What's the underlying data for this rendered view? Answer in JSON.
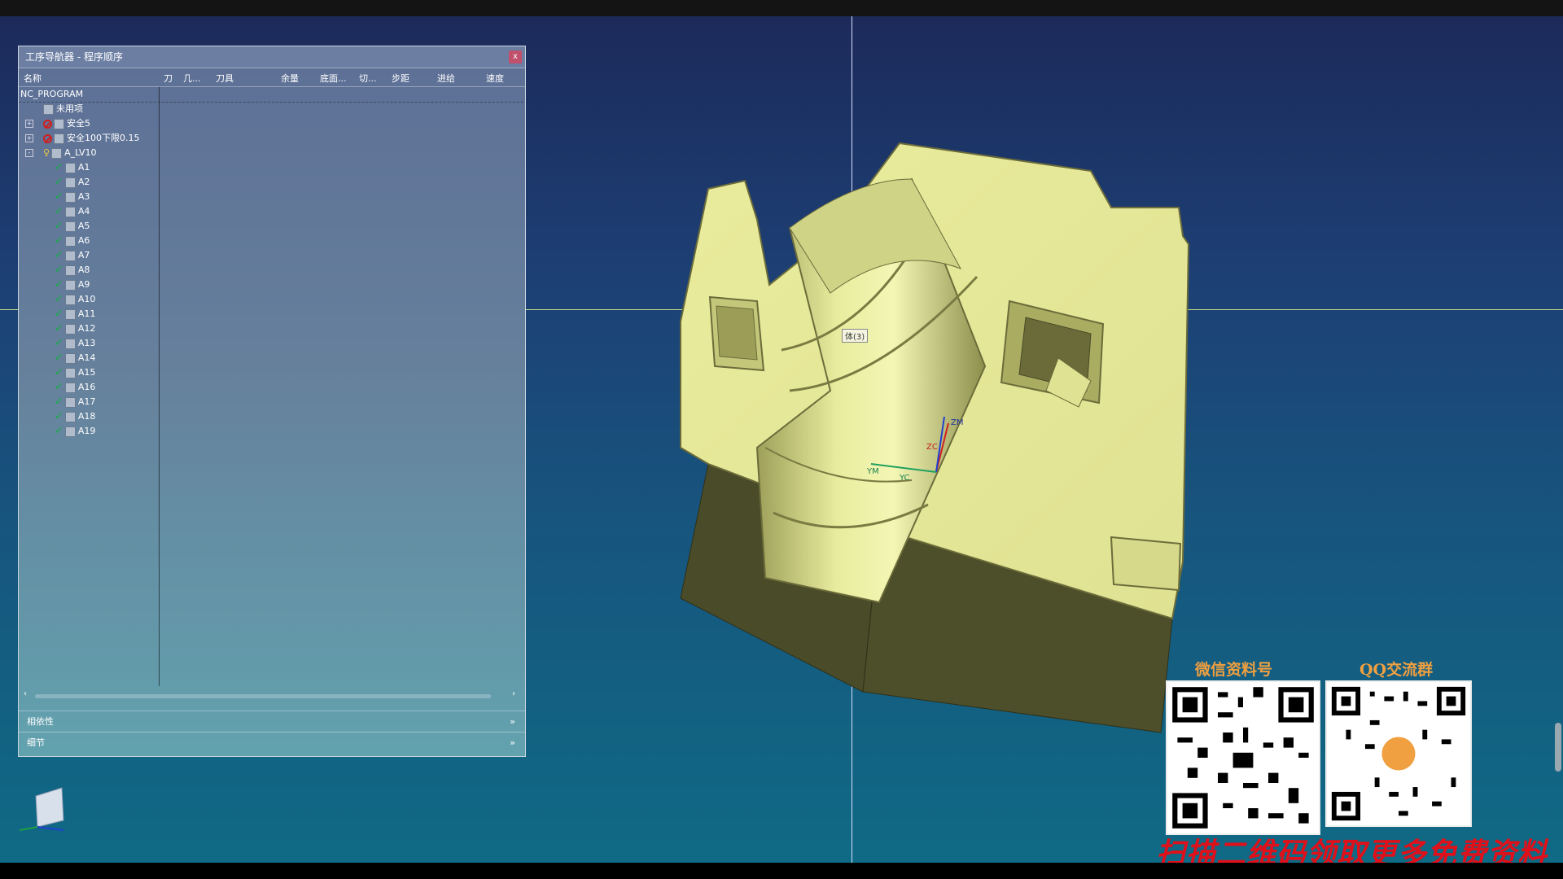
{
  "panel": {
    "title": "工序导航器 - 程序顺序",
    "close_label": "x",
    "columns": [
      "名称",
      "刀",
      "几...",
      "刀具",
      "余量",
      "底面...",
      "切...",
      "步距",
      "进给",
      "速度"
    ],
    "tree": [
      {
        "label": "NC_PROGRAM",
        "status": "none",
        "level": 0,
        "expander": ""
      },
      {
        "label": "未用项",
        "status": "none",
        "level": 1,
        "expander": ""
      },
      {
        "label": "安全5",
        "status": "blocked",
        "level": 1,
        "expander": "+"
      },
      {
        "label": "安全100下限0.15",
        "status": "blocked",
        "level": 1,
        "expander": "+"
      },
      {
        "label": "A_LV10",
        "status": "pending",
        "level": 1,
        "expander": "-"
      },
      {
        "label": "A1",
        "status": "ok",
        "level": 2,
        "expander": ""
      },
      {
        "label": "A2",
        "status": "ok",
        "level": 2,
        "expander": ""
      },
      {
        "label": "A3",
        "status": "ok",
        "level": 2,
        "expander": ""
      },
      {
        "label": "A4",
        "status": "ok",
        "level": 2,
        "expander": ""
      },
      {
        "label": "A5",
        "status": "ok",
        "level": 2,
        "expander": ""
      },
      {
        "label": "A6",
        "status": "ok",
        "level": 2,
        "expander": ""
      },
      {
        "label": "A7",
        "status": "ok",
        "level": 2,
        "expander": ""
      },
      {
        "label": "A8",
        "status": "ok",
        "level": 2,
        "expander": ""
      },
      {
        "label": "A9",
        "status": "ok",
        "level": 2,
        "expander": ""
      },
      {
        "label": "A10",
        "status": "ok",
        "level": 2,
        "expander": ""
      },
      {
        "label": "A11",
        "status": "ok",
        "level": 2,
        "expander": ""
      },
      {
        "label": "A12",
        "status": "ok",
        "level": 2,
        "expander": ""
      },
      {
        "label": "A13",
        "status": "ok",
        "level": 2,
        "expander": ""
      },
      {
        "label": "A14",
        "status": "ok",
        "level": 2,
        "expander": ""
      },
      {
        "label": "A15",
        "status": "ok",
        "level": 2,
        "expander": ""
      },
      {
        "label": "A16",
        "status": "ok",
        "level": 2,
        "expander": ""
      },
      {
        "label": "A17",
        "status": "ok",
        "level": 2,
        "expander": ""
      },
      {
        "label": "A18",
        "status": "ok",
        "level": 2,
        "expander": ""
      },
      {
        "label": "A19",
        "status": "ok",
        "level": 2,
        "expander": ""
      }
    ],
    "sections": [
      {
        "label": "相依性",
        "chevron": "»"
      },
      {
        "label": "细节",
        "chevron": "»"
      }
    ],
    "scroll_left": "‹",
    "scroll_right": "›"
  },
  "viewport": {
    "cursor_tip": "体(3)",
    "model_color": "#e6e89a",
    "axis_labels": {
      "z": "ZM",
      "zc": "ZC",
      "ym": "YM",
      "yc": "YC"
    }
  },
  "overlay": {
    "wechat_label": "微信资料号",
    "qq_label": "QQ交流群",
    "bottom_text": "扫描二维码领取更多免费资料"
  },
  "colors": {
    "viewport_top": "#1c2a5a",
    "viewport_bottom": "#0f6a85",
    "crosshair": "#c8e08a",
    "status_ok": "#10b040",
    "status_blocked": "#d02020",
    "promo_text": "#e0101a",
    "qr_label": "#f0a040"
  }
}
